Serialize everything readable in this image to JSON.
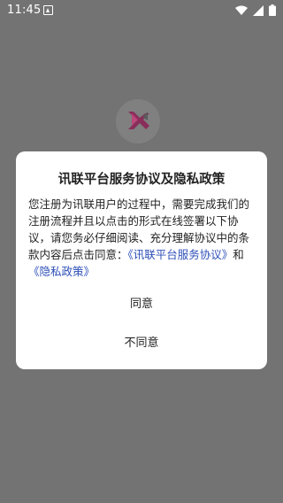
{
  "status_bar": {
    "time": "11:45",
    "icons": [
      "notification-icon",
      "wifi-icon",
      "signal-icon",
      "battery-icon"
    ]
  },
  "dialog": {
    "title": "讯联平台服务协议及隐私政策",
    "body_text": "您注册为讯联用户的过程中，需要完成我们的注册流程并且以点击的形式在线签署以下协议，请您务必仔细阅读、充分理解协议中的条款内容后点击同意：",
    "link_service": "《讯联平台服务协议》",
    "conjunction": "和",
    "link_privacy": "《隐私政策》",
    "agree_label": "同意",
    "disagree_label": "不同意"
  },
  "colors": {
    "overlay": "#737373",
    "link": "#2d4fb8",
    "logo_pink": "#b0306a"
  }
}
